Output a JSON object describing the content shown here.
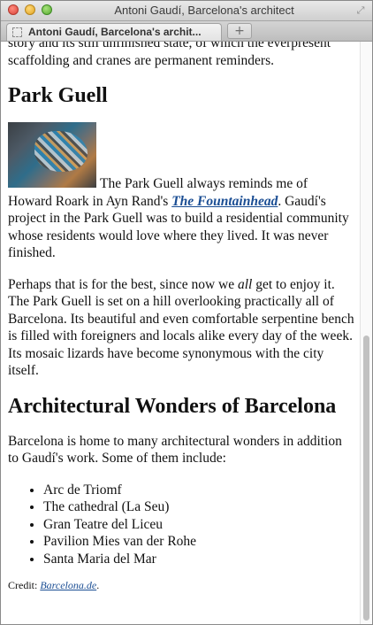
{
  "window": {
    "title": "Antoni Gaudí, Barcelona's architect"
  },
  "tabs": [
    {
      "label": "Antoni Gaudí, Barcelona's archit..."
    }
  ],
  "new_tab_label": "+",
  "icons": {
    "fullscreen": "fullscreen-icon",
    "favicon": "page-icon",
    "thumbnail": "park-guell-mosaic-lizard-image"
  },
  "article": {
    "intro_tail": "story and its still unfinished state, of which the everpresent scaffolding and cranes are permanent reminders.",
    "section1": {
      "heading": "Park Guell",
      "p1_before": "The Park Guell always reminds me of Howard Roark in Ayn Rand's ",
      "p1_link": "The Fountainhead",
      "p1_after": ". Gaudí's project in the Park Guell was to build a residential community whose residents would love where they lived. It was never finished.",
      "p2_before": "Perhaps that is for the best, since now we ",
      "p2_em": "all",
      "p2_after": " get to enjoy it. The Park Guell is set on a hill overlooking practically all of Barcelona. Its beautiful and even comfortable serpentine bench is filled with foreigners and locals alike every day of the week. Its mosaic lizards have become synonymous with the city itself."
    },
    "section2": {
      "heading": "Architectural Wonders of Barcelona",
      "intro": "Barcelona is home to many architectural wonders in addition to Gaudí's work. Some of them include:",
      "items": [
        "Arc de Triomf",
        "The cathedral (La Seu)",
        "Gran Teatre del Liceu",
        "Pavilion Mies van der Rohe",
        "Santa Maria del Mar"
      ]
    },
    "credit_label": "Credit: ",
    "credit_link": "Barcelona.de",
    "credit_after": "."
  },
  "colors": {
    "link": "#1a4d93",
    "text": "#111111"
  }
}
